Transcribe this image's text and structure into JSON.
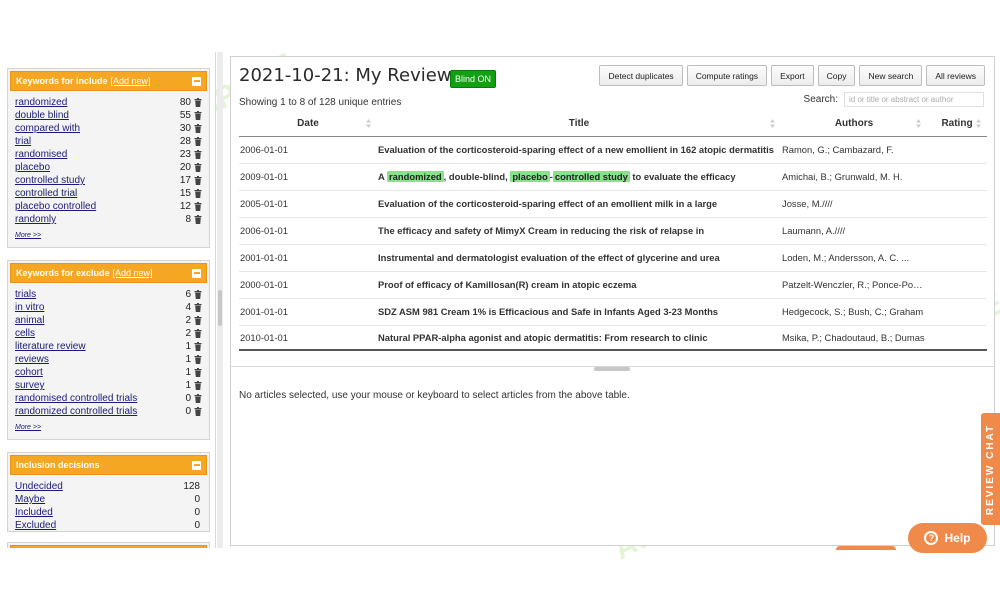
{
  "sidebar": {
    "include_panel": {
      "title": "Keywords for include",
      "add_label": "[Add new]",
      "items": [
        {
          "label": "randomized",
          "count": "80"
        },
        {
          "label": "double blind",
          "count": "55"
        },
        {
          "label": "compared with",
          "count": "30"
        },
        {
          "label": "trial",
          "count": "28"
        },
        {
          "label": "randomised",
          "count": "23"
        },
        {
          "label": "placebo",
          "count": "20"
        },
        {
          "label": "controlled study",
          "count": "17"
        },
        {
          "label": "controlled trial",
          "count": "15"
        },
        {
          "label": "placebo controlled",
          "count": "12"
        },
        {
          "label": "randomly",
          "count": "8"
        }
      ],
      "more_label": "More >>"
    },
    "exclude_panel": {
      "title": "Keywords for exclude",
      "add_label": "[Add new]",
      "items": [
        {
          "label": "trials",
          "count": "6"
        },
        {
          "label": "in vitro",
          "count": "4"
        },
        {
          "label": "animal",
          "count": "2"
        },
        {
          "label": "cells",
          "count": "2"
        },
        {
          "label": "literature review",
          "count": "1"
        },
        {
          "label": "reviews",
          "count": "1"
        },
        {
          "label": "cohort",
          "count": "1"
        },
        {
          "label": "survey",
          "count": "1"
        },
        {
          "label": "randomised controlled trials",
          "count": "0"
        },
        {
          "label": "randomized controlled trials",
          "count": "0"
        }
      ],
      "more_label": "More >>"
    },
    "decisions_panel": {
      "title": "Inclusion decisions",
      "items": [
        {
          "label": "Undecided",
          "count": "128"
        },
        {
          "label": "Maybe",
          "count": "0"
        },
        {
          "label": "Included",
          "count": "0"
        },
        {
          "label": "Excluded",
          "count": "0"
        }
      ]
    }
  },
  "main": {
    "title": "2021-10-21: My Review",
    "blind_badge": "Blind ON",
    "showing_text": "Showing 1 to 8 of 128 unique entries",
    "toolbar": {
      "detect_duplicates": "Detect duplicates",
      "compute_ratings": "Compute ratings",
      "export": "Export",
      "copy": "Copy",
      "new_search": "New search",
      "all_reviews": "All reviews"
    },
    "search": {
      "label": "Search:",
      "placeholder": "id or title or abstract or author"
    },
    "table": {
      "headers": {
        "date": "Date",
        "title": "Title",
        "authors": "Authors",
        "rating": "Rating"
      },
      "rows": [
        {
          "date": "2006-01-01",
          "title": "Evaluation of the corticosteroid-sparing effect of a new emollient in 162 atopic dermatitis",
          "authors": "Ramon, G.; Cambazard, F."
        },
        {
          "date": "2009-01-01",
          "title_parts": {
            "a": "A ",
            "m1": "randomized",
            "b": ", double-blind, ",
            "m2": "placebo",
            "c": "-",
            "m3": "controlled study",
            "d": " to evaluate the efficacy"
          },
          "authors": "Amichai, B.; Grunwald, M. H."
        },
        {
          "date": "2005-01-01",
          "title": "Evaluation of the corticosteroid-sparing effect of an emollient milk in a large",
          "authors": "Josse, M.////"
        },
        {
          "date": "2006-01-01",
          "title": "The efficacy and safety of MimyX Cream in reducing the risk of relapse in",
          "authors": "Laumann, A.////"
        },
        {
          "date": "2001-01-01",
          "title": "Instrumental and dermatologist evaluation of the effect of glycerine and urea",
          "authors": "Loden, M.; Andersson, A. C. ..."
        },
        {
          "date": "2000-01-01",
          "title": "Proof of efficacy of Kamillosan(R) cream in atopic eczema",
          "authors": "Patzelt-Wenczler, R.; Ponce-Poschl, E."
        },
        {
          "date": "2001-01-01",
          "title": "SDZ ASM 981 Cream 1% is Efficacious and Safe in Infants Aged 3-23 Months",
          "authors": "Hedgecock, S.; Bush, C.; Graham"
        },
        {
          "date": "2010-01-01",
          "title": "Natural PPAR-alpha agonist and atopic dermatitis: From research to clinic",
          "authors": "Msika, P.; Chadoutaud, B.; Dumas"
        }
      ]
    },
    "detail_message": "No articles selected, use your mouse or keyboard to select articles from the above table."
  },
  "widgets": {
    "review_chat": "REVIEW CHAT",
    "help": "Help"
  },
  "watermark": "AI TALENT SPACE",
  "colors": {
    "accent": "#f5a623",
    "blind_badge": "#10a010",
    "highlight": "#8be08b",
    "chat": "#f08a4b"
  }
}
